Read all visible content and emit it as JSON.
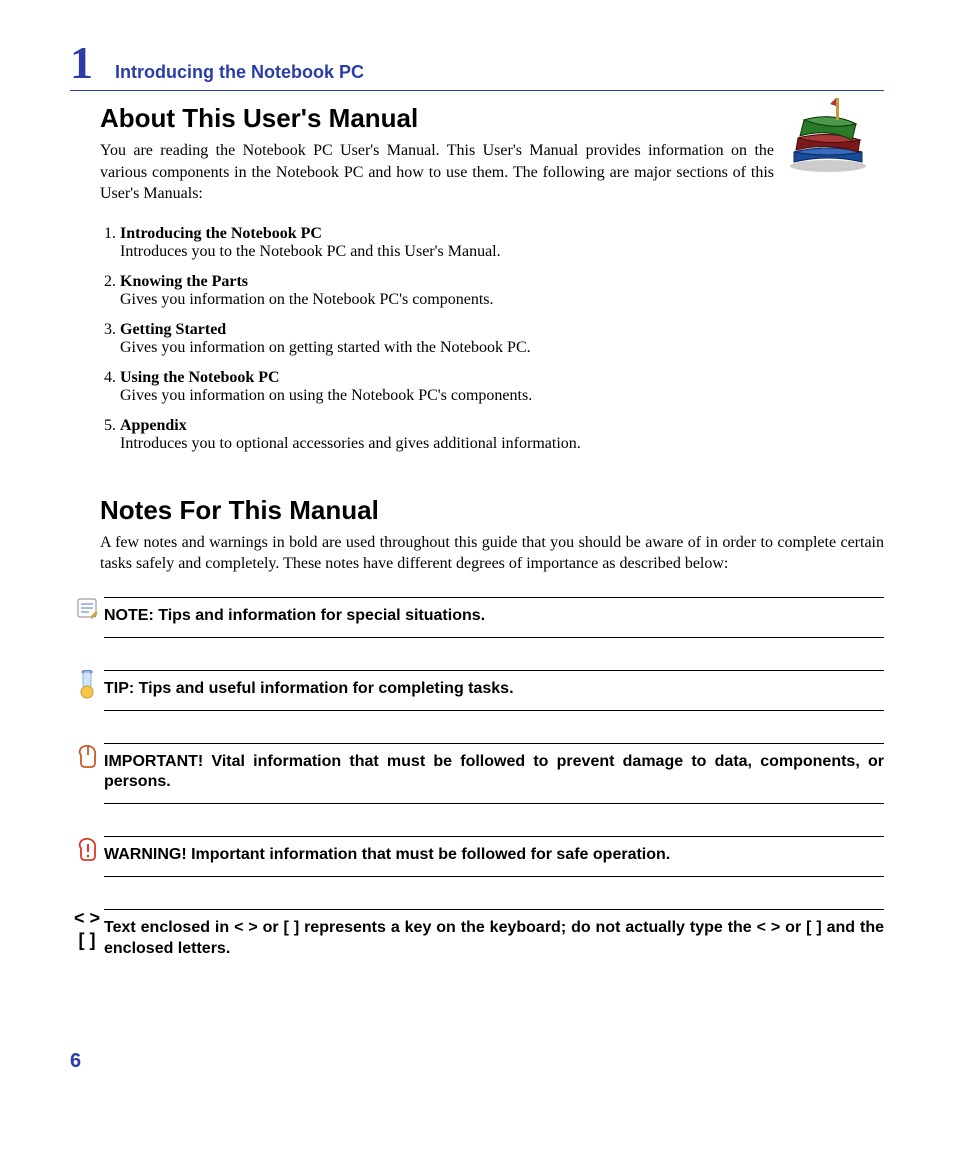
{
  "header": {
    "chapter_number": "1",
    "chapter_title": "Introducing the Notebook PC"
  },
  "section1": {
    "heading": "About This User's Manual",
    "intro": "You are reading the Notebook PC User's Manual. This User's Manual provides information on the various components in the Notebook PC and how to use them. The following are major sections of this User's Manuals:",
    "items": [
      {
        "title": "Introducing the Notebook PC",
        "desc": "Introduces you to the Notebook PC and this User's Manual."
      },
      {
        "title": "Knowing the Parts",
        "desc": "Gives you information on the Notebook PC's components."
      },
      {
        "title": "Getting Started",
        "desc": "Gives you information on getting started with the Notebook PC."
      },
      {
        "title": "Using the Notebook PC",
        "desc": "Gives you information on using the Notebook PC's components."
      },
      {
        "title": "Appendix",
        "desc": "Introduces you to optional accessories and gives additional information."
      }
    ]
  },
  "section2": {
    "heading": "Notes For This Manual",
    "intro": "A few notes and warnings in bold are used throughout this guide that you should be aware of in order to complete certain tasks safely and completely. These notes have different degrees of importance as described below:",
    "notes": [
      {
        "icon": "note-icon",
        "symbol1": "",
        "symbol2": "",
        "text": "NOTE: Tips and information for special situations."
      },
      {
        "icon": "tip-icon",
        "symbol1": "",
        "symbol2": "",
        "text": "TIP: Tips and useful information for completing tasks."
      },
      {
        "icon": "important-icon",
        "symbol1": "",
        "symbol2": "",
        "text": "IMPORTANT! Vital information that must be followed to prevent damage to data, components, or persons."
      },
      {
        "icon": "warning-icon",
        "symbol1": "",
        "symbol2": "",
        "text": "WARNING! Important information that must be followed for safe operation."
      },
      {
        "icon": "brackets-icon",
        "symbol1": "< >",
        "symbol2": "[  ]",
        "text": "Text enclosed in < > or [ ] represents a key on the keyboard; do not actually type the < > or [ ] and the enclosed letters."
      }
    ]
  },
  "page_number": "6"
}
